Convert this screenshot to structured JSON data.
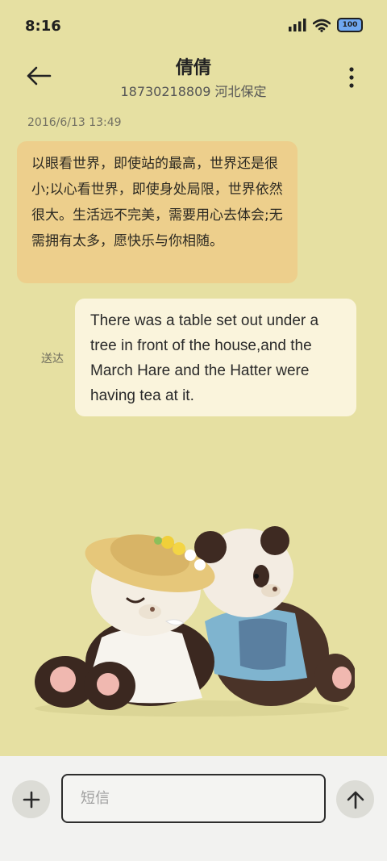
{
  "status_bar": {
    "time": "8:16",
    "battery": "100"
  },
  "header": {
    "contact_name": "倩倩",
    "contact_sub": "18730218809 河北保定"
  },
  "conversation": {
    "timestamp": "2016/6/13 13:49",
    "incoming_message": "以眼看世界，即使站的最高，世界还是很小;以心看世界，即使身处局限，世界依然很大。生活远不完美，需要用心去体会;无需拥有太多，愿快乐与你相随。",
    "outgoing_message": "There was a table set out under a tree in front of the house,and the March Hare and the Hatter were having tea at it.",
    "delivered_label": "送达"
  },
  "composer": {
    "placeholder": "短信"
  },
  "colors": {
    "background": "#e6e0a2",
    "incoming_bubble": "#edcf8c",
    "outgoing_bubble": "#faf4dc",
    "bottom_bar": "#f2f2f0"
  },
  "icons": [
    "signal-icon",
    "wifi-icon",
    "battery-icon",
    "back-arrow-icon",
    "more-vertical-icon",
    "plus-icon",
    "send-arrow-icon"
  ]
}
